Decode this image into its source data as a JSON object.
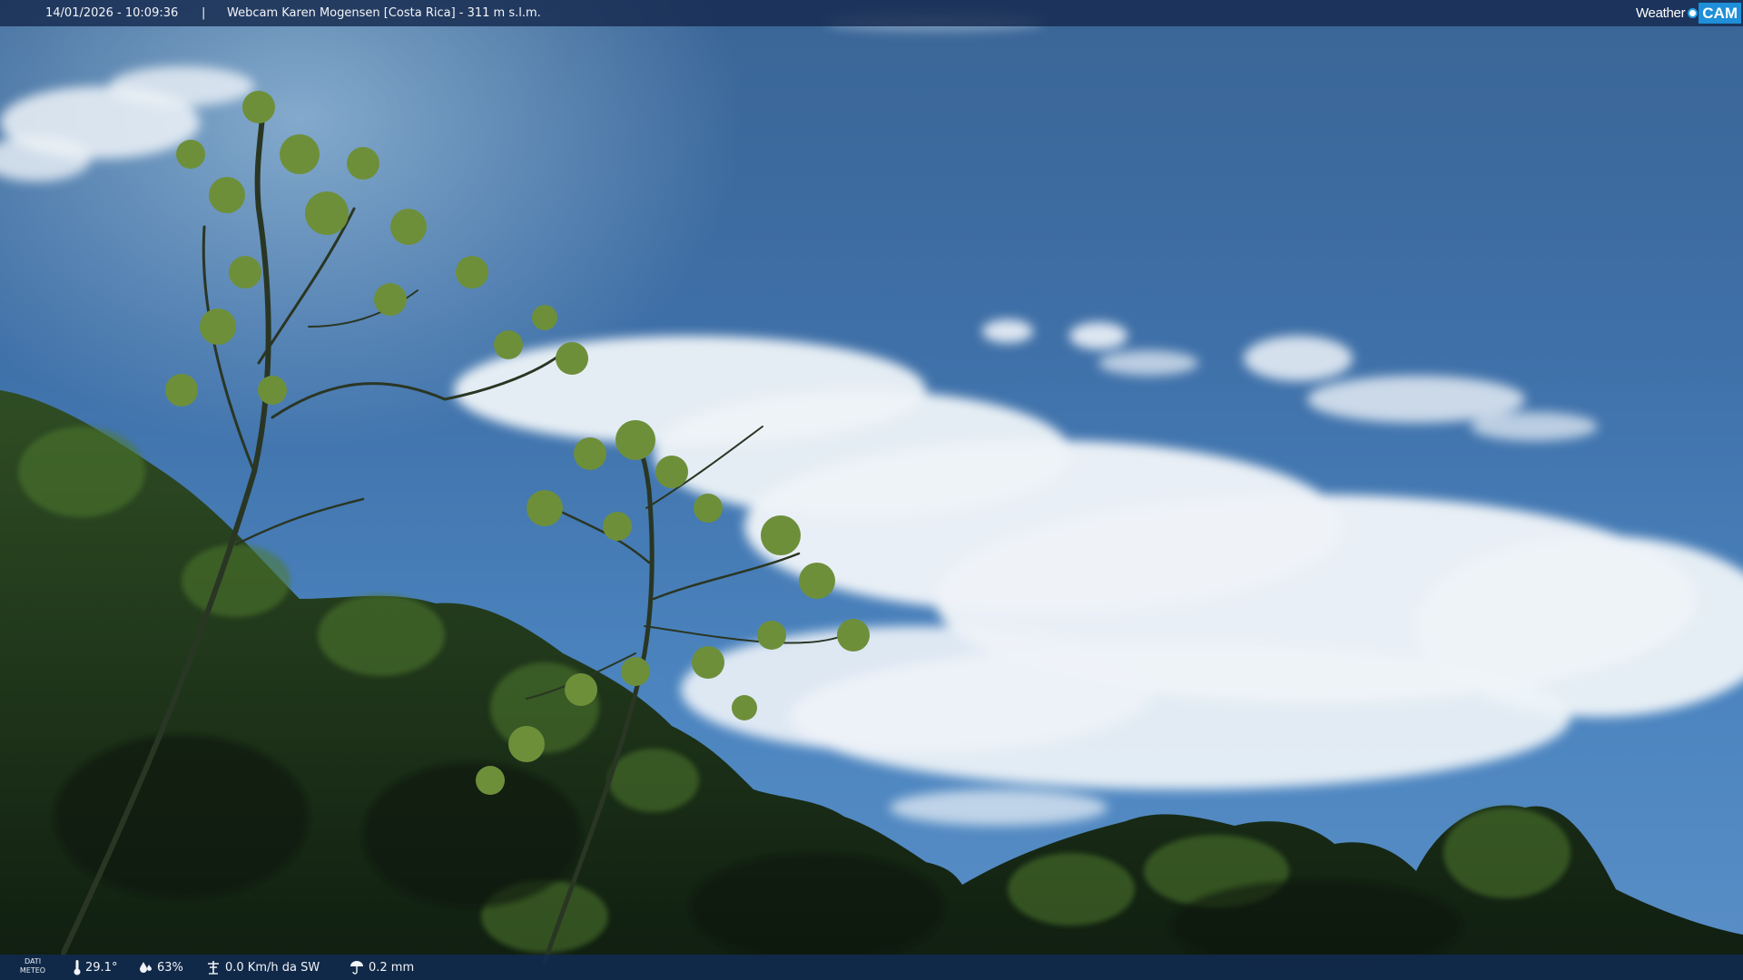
{
  "overlay": {
    "datetime": "14/01/2026 - 10:09:36",
    "separator": "|",
    "station": "Webcam Karen Mogensen [Costa Rica]  - 311 m s.l.m.",
    "logo": {
      "weather": "Weather",
      "cam": "CAM"
    }
  },
  "weather_bar": {
    "label_line1": "DATI",
    "label_line2": "METEO",
    "temperature": "29.1°",
    "humidity": "63%",
    "wind": "0.0 Km/h da SW",
    "rain": "0.2 mm",
    "icons": [
      "thermometer-icon",
      "humidity-drop-icon",
      "wind-icon",
      "rain-icon"
    ]
  },
  "scene": {
    "description_colors": {
      "sky_top": "#3a6596",
      "sky_bottom": "#5a8fc6",
      "cloud": "#eef3f8",
      "foliage_dark": "#1c3318",
      "foliage_light": "#6e8f3a"
    }
  }
}
